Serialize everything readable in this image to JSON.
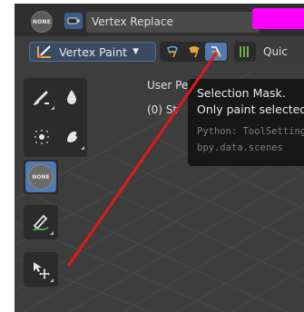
{
  "header": {
    "none_badge": "NONE",
    "brush_name": "Vertex Replace",
    "color_swatch": "#ff00ff"
  },
  "toolbar": {
    "mode_label": "Vertex Paint",
    "mode_icon": "vertex-paint-icon",
    "mask_icons": [
      "face-mask-icon",
      "vertex-mask-icon",
      "selection-mask-icon"
    ],
    "symmetry_icon": "symmetry-icon",
    "quick_label": "Quic"
  },
  "tools": {
    "items": [
      {
        "name": "draw-brush-icon"
      },
      {
        "name": "blur-drop-icon"
      },
      {
        "name": "average-icon"
      },
      {
        "name": "smear-icon"
      },
      {
        "name": "none-brush-icon",
        "label": "NONE"
      },
      {
        "name": "annotate-pen-icon"
      },
      {
        "name": "transform-move-icon"
      }
    ]
  },
  "viewport": {
    "title": "User Perspective",
    "subtitle": "(0) St"
  },
  "tooltip": {
    "title": "Selection Mask.",
    "description": "Only paint selected",
    "python": "Python: ToolSettings",
    "path": "bpy.data.scenes"
  },
  "colors": {
    "accent": "#4f7ab3",
    "annotation_line": "#e11a1a"
  }
}
